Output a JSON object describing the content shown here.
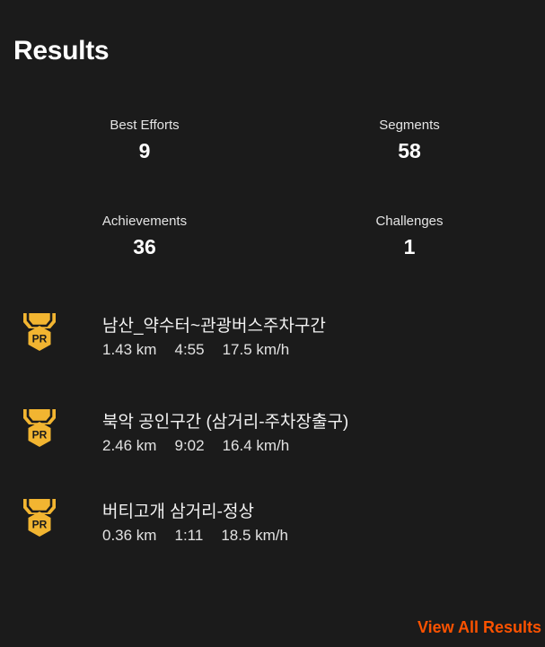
{
  "results": {
    "title": "Results",
    "stats": [
      {
        "label": "Best Efforts",
        "value": "9"
      },
      {
        "label": "Segments",
        "value": "58"
      },
      {
        "label": "Achievements",
        "value": "36"
      },
      {
        "label": "Challenges",
        "value": "1"
      }
    ],
    "segments": [
      {
        "badge": "PR",
        "name": "남산_약수터~관광버스주차구간",
        "distance": "1.43 km",
        "time": "4:55",
        "speed": "17.5 km/h"
      },
      {
        "badge": "PR",
        "name": "북악 공인구간 (삼거리-주차장출구)",
        "distance": "2.46 km",
        "time": "9:02",
        "speed": "16.4 km/h"
      },
      {
        "badge": "PR",
        "name": "버티고개 삼거리-정상",
        "distance": "0.36 km",
        "time": "1:11",
        "speed": "18.5 km/h"
      }
    ],
    "view_all_label": "View All Results"
  },
  "colors": {
    "background": "#1b1b1b",
    "accent": "#fc5200",
    "medal": "#f2b531"
  },
  "icons": {
    "segment_badge": "pr-medal-icon"
  }
}
